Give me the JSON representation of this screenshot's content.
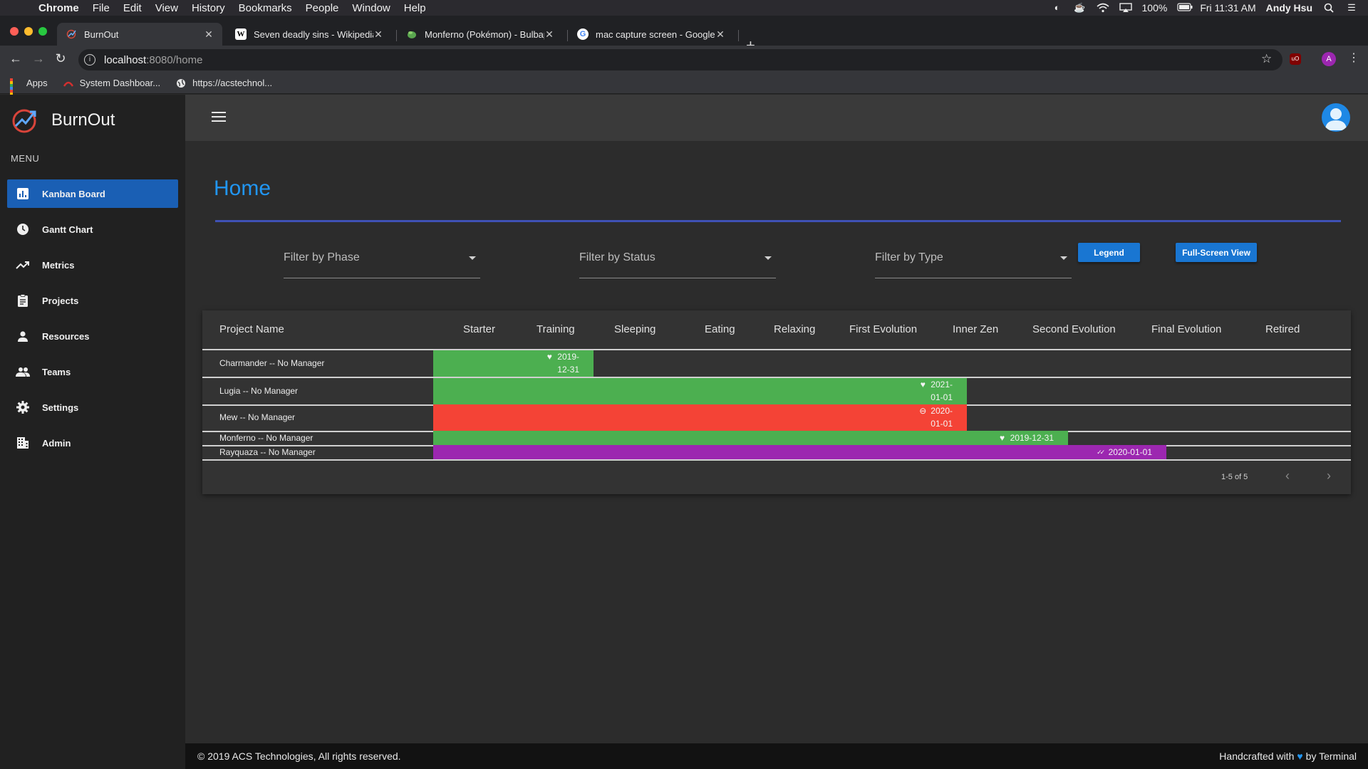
{
  "macos": {
    "menu": [
      "Chrome",
      "File",
      "Edit",
      "View",
      "History",
      "Bookmarks",
      "People",
      "Window",
      "Help"
    ],
    "battery": "100%",
    "clock": "Fri 11:31 AM",
    "user": "Andy Hsu"
  },
  "browser": {
    "tabs": [
      {
        "title": "BurnOut",
        "active": true
      },
      {
        "title": "Seven deadly sins - Wikipedia",
        "active": false
      },
      {
        "title": "Monferno (Pokémon) - Bulbap",
        "active": false
      },
      {
        "title": "mac capture screen - Google S",
        "active": false
      }
    ],
    "url_host": "localhost",
    "url_rest": ":8080/home",
    "profile_initial": "A",
    "bookmarks": [
      "Apps",
      "System Dashboar...",
      "https://acstechnol..."
    ]
  },
  "app": {
    "name": "BurnOut",
    "menu_label": "MENU",
    "nav": [
      {
        "label": "Kanban Board",
        "icon": "bar-chart-icon",
        "active": true
      },
      {
        "label": "Gantt Chart",
        "icon": "clock-icon",
        "active": false
      },
      {
        "label": "Metrics",
        "icon": "trending-up-icon",
        "active": false
      },
      {
        "label": "Projects",
        "icon": "clipboard-icon",
        "active": false
      },
      {
        "label": "Resources",
        "icon": "person-icon",
        "active": false
      },
      {
        "label": "Teams",
        "icon": "people-icon",
        "active": false
      },
      {
        "label": "Settings",
        "icon": "gear-icon",
        "active": false
      },
      {
        "label": "Admin",
        "icon": "building-icon",
        "active": false
      }
    ]
  },
  "page": {
    "title": "Home",
    "filters": [
      "Filter by Phase",
      "Filter by Status",
      "Filter by Type"
    ],
    "legend_button": "Legend",
    "fullscreen_button": "Full-Screen View"
  },
  "gantt": {
    "columns": [
      "Project Name",
      "Starter",
      "Training",
      "Sleeping",
      "Eating",
      "Relaxing",
      "First Evolution",
      "Inner Zen",
      "Second Evolution",
      "Final Evolution",
      "Retired"
    ],
    "rows": [
      {
        "name": "Charmander -- No Manager",
        "date": "2019-12-31",
        "date_lines": [
          "2019-",
          "12-31"
        ],
        "status_icon": "heart-icon",
        "color": "#4caf50",
        "phase_end": 2
      },
      {
        "name": "Lugia -- No Manager",
        "date": "2021-01-01",
        "date_lines": [
          "2021-",
          "01-01"
        ],
        "status_icon": "heart-icon",
        "color": "#4caf50",
        "phase_end": 7
      },
      {
        "name": "Mew -- No Manager",
        "date": "2020-01-01",
        "date_lines": [
          "2020-",
          "01-01"
        ],
        "status_icon": "minus-circle-icon",
        "color": "#f44336",
        "phase_end": 7
      },
      {
        "name": "Monferno -- No Manager",
        "date": "2019-12-31",
        "date_lines": [
          "2019-12-31"
        ],
        "status_icon": "heart-icon",
        "color": "#4caf50",
        "phase_end": 8
      },
      {
        "name": "Rayquaza -- No Manager",
        "date": "2020-01-01",
        "date_lines": [
          "2020-01-01"
        ],
        "status_icon": "double-check-icon",
        "color": "#9c27b0",
        "phase_end": 9
      }
    ],
    "pagination": "1-5 of 5"
  },
  "footer": {
    "copyright": "© 2019 ACS Technologies, All rights reserved.",
    "handcrafted": "Handcrafted with",
    "by": "by Terminal"
  }
}
